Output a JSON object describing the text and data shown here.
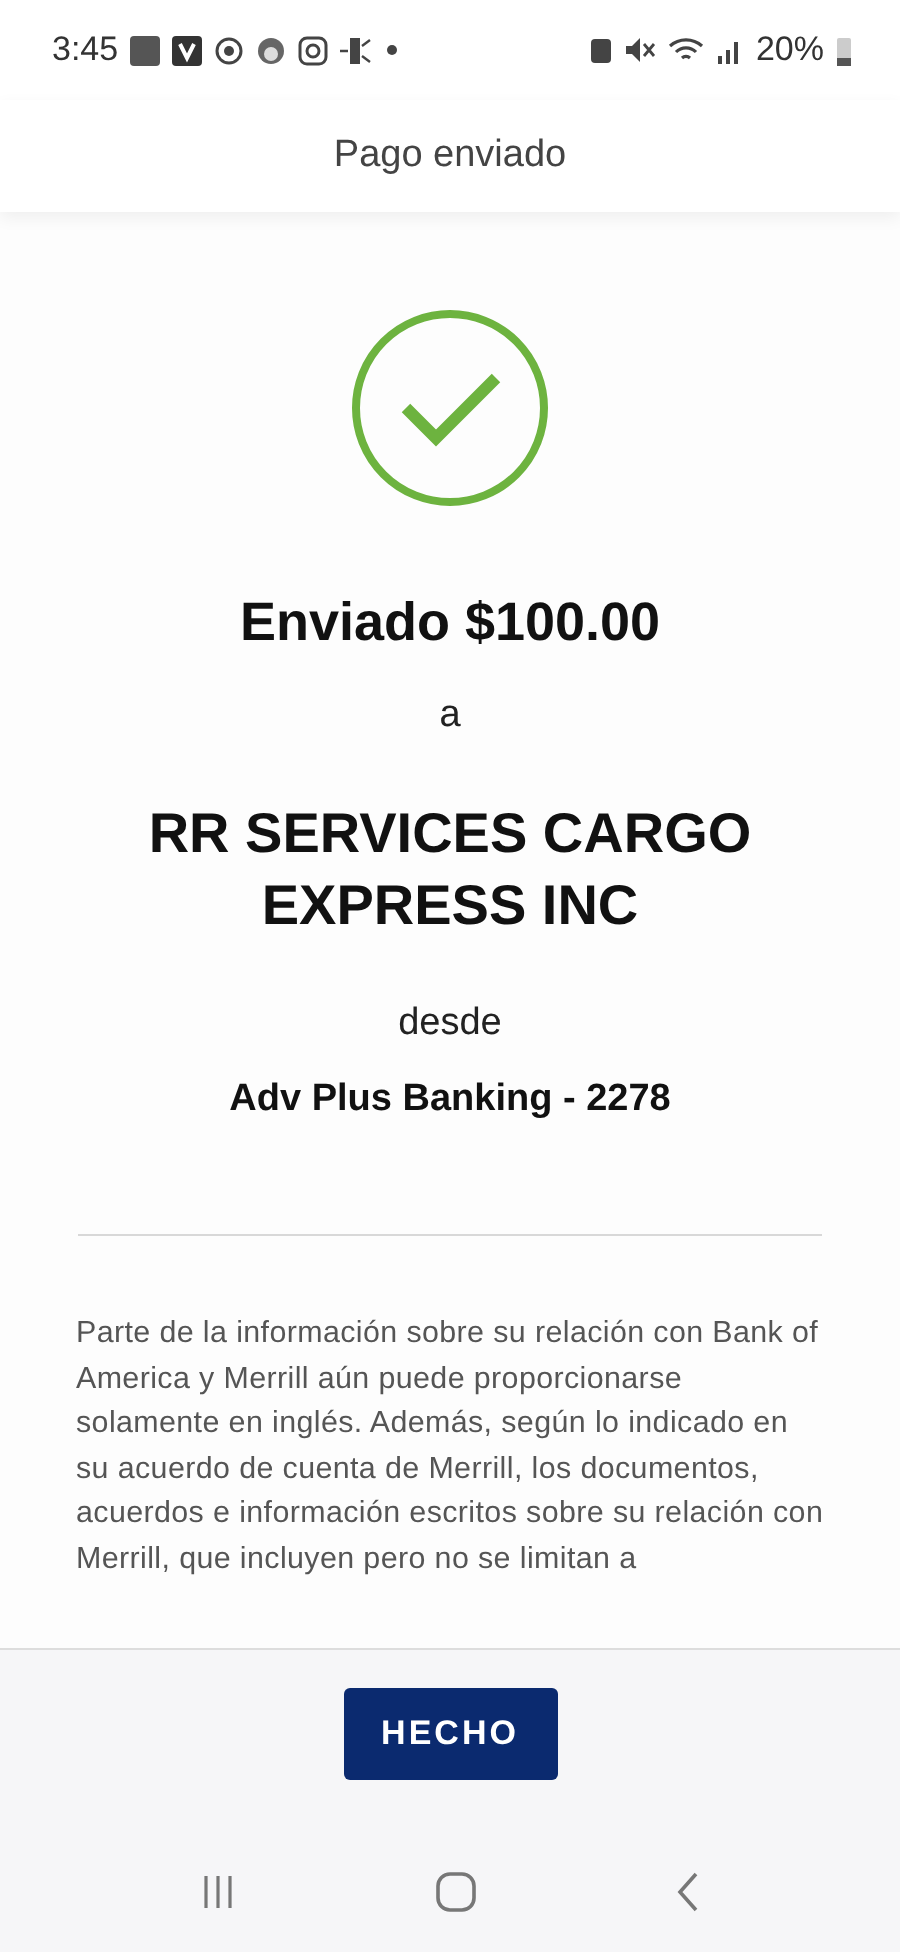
{
  "status_bar": {
    "time": "3:45",
    "battery": "20%"
  },
  "header": {
    "title": "Pago enviado"
  },
  "confirmation": {
    "amount_line": "Enviado $100.00",
    "to_word": "a",
    "recipient": "RR SERVICES CARGO EXPRESS INC",
    "from_word": "desde",
    "account": "Adv Plus Banking - 2278"
  },
  "disclaimer": "Parte de la información sobre su relación con Bank of America y Merrill aún puede proporcionarse solamente en inglés. Además, según lo indicado en su acuerdo de cuenta de Merrill, los documentos, acuerdos e información escritos sobre su relación con Merrill, que incluyen pero no se limitan a",
  "footer": {
    "done_button": "HECHO"
  }
}
